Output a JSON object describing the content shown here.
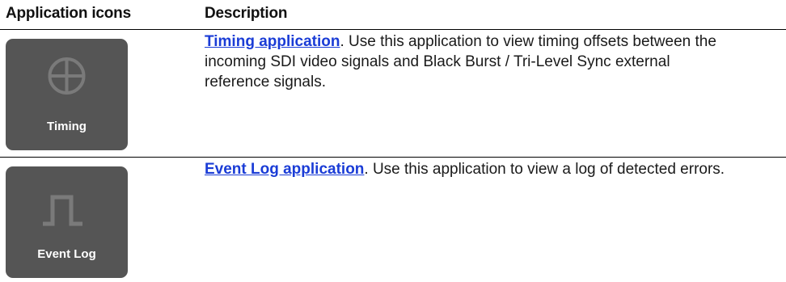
{
  "header": {
    "icons_column": "Application icons",
    "description_column": "Description"
  },
  "rows": [
    {
      "icon_label": "Timing",
      "icon_name": "crosshair-circle-icon",
      "link_text": "Timing application",
      "description": ". Use this application to view timing offsets between the incoming SDI video signals and Black Burst / Tri-Level Sync external reference signals."
    },
    {
      "icon_label": "Event Log",
      "icon_name": "pulse-waveform-icon",
      "link_text": "Event Log application",
      "description": ". Use this application to view a log of detected errors."
    }
  ],
  "colors": {
    "icon_tile": "#555555",
    "icon_glyph": "#7a7a7a",
    "link": "#1a3cd6"
  }
}
